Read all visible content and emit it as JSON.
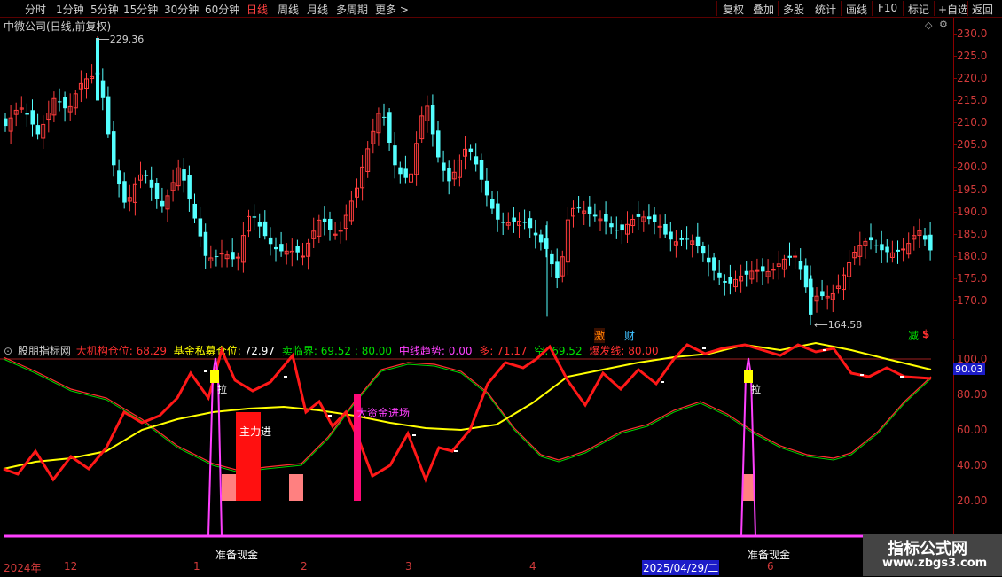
{
  "toolbar": {
    "left": [
      "分时",
      "1分钟",
      "5分钟",
      "15分钟",
      "30分钟",
      "60分钟",
      "日线",
      "周线",
      "月线",
      "多周期",
      "更多 >"
    ],
    "right": [
      "复权",
      "叠加",
      "多股",
      "统计",
      "画线",
      "F10",
      "标记",
      "+自选",
      "返回"
    ]
  },
  "main": {
    "title": "中微公司(日线,前复权)",
    "high_label": "229.36",
    "low_label": "164.58",
    "markers": [
      "激",
      "财",
      "减",
      "$"
    ],
    "axis_ticks": [
      "230.0",
      "225.0",
      "220.0",
      "215.0",
      "210.0",
      "205.0",
      "200.0",
      "195.0",
      "190.0",
      "185.0",
      "180.0",
      "175.0",
      "170.0"
    ]
  },
  "indicator": {
    "name": "股朋指标网",
    "items": [
      {
        "label": "大机构仓位: ",
        "value": "68.29",
        "color": "#ff3030"
      },
      {
        "label": "基金私募仓位: ",
        "value": "72.97",
        "color": "#ffff00"
      },
      {
        "label": "卖临界: ",
        "value": "69.52 : 80.00",
        "color": "#00e000"
      },
      {
        "label": "中线趋势: ",
        "value": "0.00",
        "color": "#ff40ff"
      },
      {
        "label": "多: ",
        "value": "71.17",
        "color": "#ff3030"
      },
      {
        "label": "空: ",
        "value": "69.52",
        "color": "#00e000"
      },
      {
        "label": "爆发线: ",
        "value": "80.00",
        "color": "#ff3030"
      }
    ],
    "axis_ticks": [
      "100.0",
      "80.00",
      "60.00",
      "40.00",
      "20.00"
    ],
    "current_value": "90.03",
    "annotations": {
      "zhuli": "主力进",
      "dazijin": "大资金进场",
      "la1": "拉",
      "la2": "拉",
      "zhunbei1": "准备现金",
      "zhunbei2": "准备现金"
    }
  },
  "bottom_axis": [
    "2024年",
    "12",
    "1",
    "2",
    "3",
    "4",
    "2025/04/29/二",
    "6"
  ],
  "watermark": {
    "line1": "指标公式网",
    "line2": "www.zbgs3.com"
  }
}
